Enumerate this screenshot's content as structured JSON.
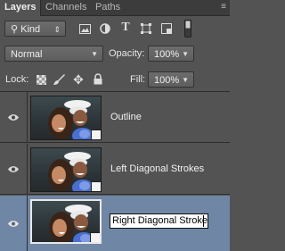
{
  "tabs": [
    {
      "label": "Layers",
      "active": true
    },
    {
      "label": "Channels",
      "active": false
    },
    {
      "label": "Paths",
      "active": false
    }
  ],
  "filter": {
    "kind_label": "Kind"
  },
  "blend": {
    "mode": "Normal"
  },
  "opacity": {
    "label": "Opacity:",
    "value": "100%"
  },
  "lock": {
    "label": "Lock:"
  },
  "fill": {
    "label": "Fill:",
    "value": "100%"
  },
  "layers": [
    {
      "name": "Outline",
      "selected": false,
      "visible": true
    },
    {
      "name": "Left Diagonal Strokes",
      "selected": false,
      "visible": true
    },
    {
      "name": "Right Diagonal Strokes",
      "selected": true,
      "visible": true,
      "editing": true
    }
  ],
  "colors": {
    "panel": "#535353",
    "selected_row": "#6f86a5",
    "tabbar": "#3c3c3c"
  }
}
